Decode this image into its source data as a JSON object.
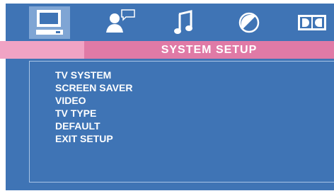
{
  "title": "SYSTEM SETUP",
  "tabs": [
    {
      "name": "monitor-icon",
      "selected": true
    },
    {
      "name": "person-speech-icon",
      "selected": false
    },
    {
      "name": "music-note-icon",
      "selected": false
    },
    {
      "name": "contrast-circle-icon",
      "selected": false
    },
    {
      "name": "dolby-icon",
      "selected": false
    }
  ],
  "menu": {
    "items": [
      "TV SYSTEM",
      "SCREEN SAVER",
      "VIDEO",
      "TV TYPE",
      "DEFAULT",
      "EXIT SETUP"
    ]
  },
  "colors": {
    "panel": "#3f74b5",
    "selected_tab": "#7fa5d4",
    "pink_bar": "#f0a3c4",
    "title_bg": "#e07aa6",
    "text": "#ffffff"
  }
}
